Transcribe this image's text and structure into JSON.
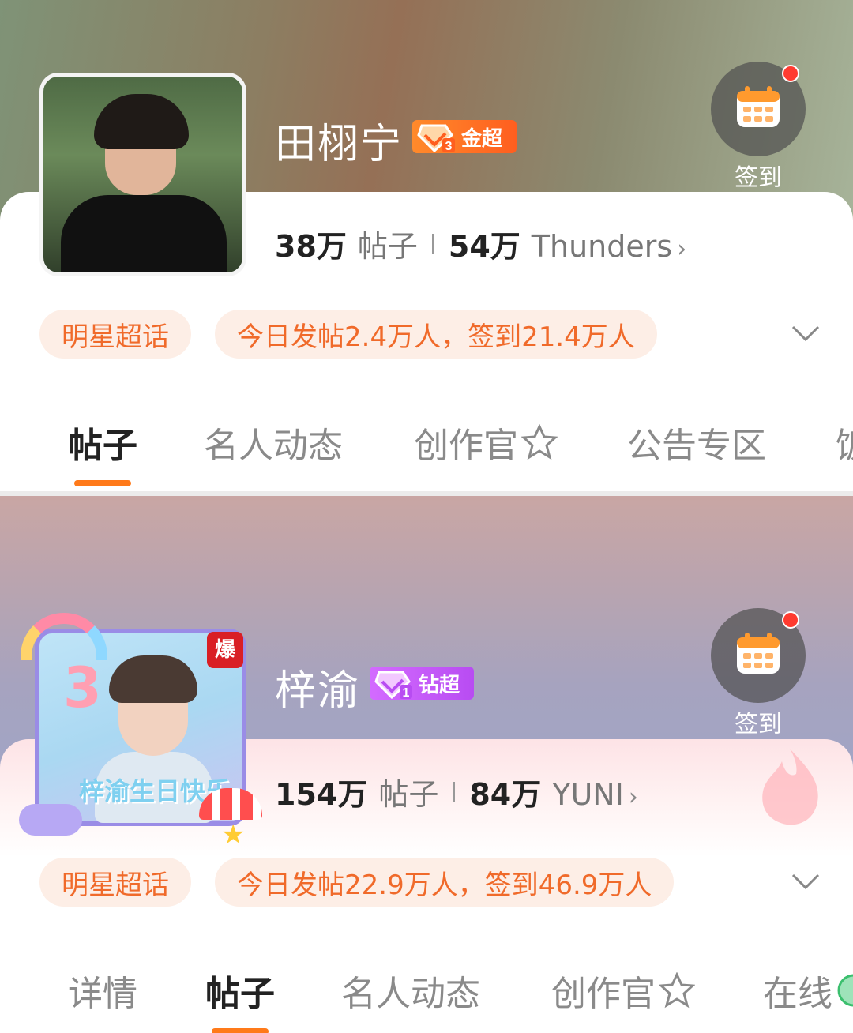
{
  "cards": [
    {
      "name": "田栩宁",
      "level_badge": {
        "level": "3",
        "label": "金超",
        "color": "#ff6a22"
      },
      "checkin_label": "签到",
      "stats": {
        "posts_num": "38万",
        "posts_unit": "帖子",
        "fans_num": "54万",
        "fans_unit": "Thunders"
      },
      "tags": {
        "category": "明星超话",
        "activity": "今日发帖2.4万人，签到21.4万人"
      },
      "tabs": [
        "帖子",
        "名人动态",
        "创作官",
        "公告专区",
        "饭"
      ],
      "active_tab": "帖子"
    },
    {
      "name": "梓渝",
      "level_badge": {
        "level": "1",
        "label": "钻超",
        "color": "#c458f5"
      },
      "avatar_badge": "爆",
      "checkin_label": "签到",
      "stats": {
        "posts_num": "154万",
        "posts_unit": "帖子",
        "fans_num": "84万",
        "fans_unit": "YUNI"
      },
      "tags": {
        "category": "明星超话",
        "activity": "今日发帖22.9万人，签到46.9万人"
      },
      "tabs": [
        "详情",
        "帖子",
        "名人动态",
        "创作官",
        "在线"
      ],
      "active_tab": "帖子"
    }
  ],
  "accent_color": "#ff7a1a"
}
